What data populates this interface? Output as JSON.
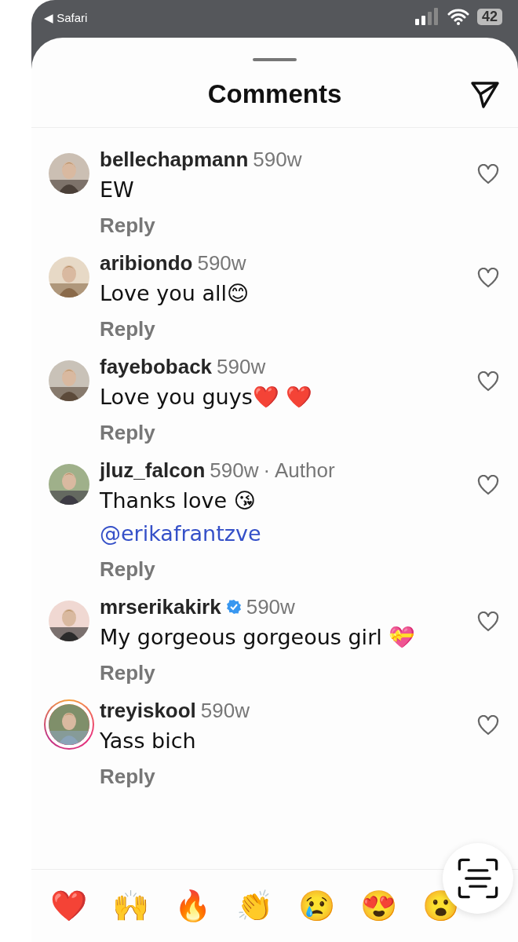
{
  "status_bar": {
    "back_label": "◀ Safari",
    "battery": "42"
  },
  "sheet": {
    "title": "Comments"
  },
  "comments": [
    {
      "user": "bellechapmann",
      "verified": false,
      "time": "590w",
      "text": "EW",
      "story_ring": false,
      "reply": "Reply"
    },
    {
      "user": "aribiondo",
      "verified": false,
      "time": "590w",
      "text": "Love you all😊",
      "story_ring": false,
      "reply": "Reply"
    },
    {
      "user": "fayeboback",
      "verified": false,
      "time": "590w",
      "text": "Love you guys❤️ ❤️",
      "story_ring": false,
      "reply": "Reply"
    },
    {
      "user": "jluz_falcon",
      "verified": false,
      "time": "590w",
      "author_tag": "· Author",
      "text": "Thanks love 😘",
      "mention": "@erikafrantzve",
      "story_ring": false,
      "reply": "Reply"
    },
    {
      "user": "mrserikakirk",
      "verified": true,
      "time": "590w",
      "text": "My gorgeous gorgeous girl 💝",
      "story_ring": false,
      "reply": "Reply"
    },
    {
      "user": "treyiskool",
      "verified": false,
      "time": "590w",
      "text": "Yass bich",
      "story_ring": true,
      "reply": "Reply"
    }
  ],
  "reactions": [
    "❤️",
    "🙌",
    "🔥",
    "👏",
    "😢",
    "😍",
    "😮"
  ]
}
